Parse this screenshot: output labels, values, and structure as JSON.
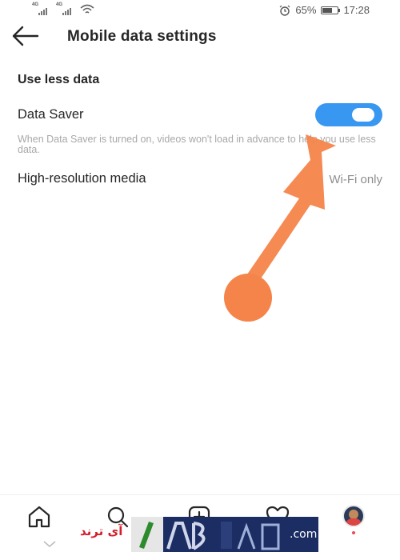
{
  "status_bar": {
    "network_1": "4G",
    "network_2": "4G",
    "battery": "65%",
    "battery_level": 0.65,
    "time": "17:28",
    "icons": [
      "signal-icon",
      "signal-icon",
      "wifi-icon",
      "alarm-icon",
      "battery-icon"
    ]
  },
  "header": {
    "back_icon": "arrow-left-icon",
    "title": "Mobile data settings"
  },
  "section": {
    "title": "Use less data"
  },
  "data_saver": {
    "label": "Data Saver",
    "enabled": true,
    "toggle_color": "#3897f0",
    "help_text": "When Data Saver is turned on, videos won't load in advance to help you use less data."
  },
  "high_res": {
    "label": "High-resolution media",
    "value": "Wi-Fi only"
  },
  "overlay": {
    "arrow_color": "#f4844a"
  },
  "bottom_nav": {
    "items": [
      "home-icon",
      "search-icon",
      "new-post-icon",
      "activity-heart-icon",
      "profile-avatar"
    ],
    "notification_dot_color": "#ed4956"
  },
  "watermark": {
    "text_fa": "آی ترند",
    "text_dotcom": ".com"
  }
}
